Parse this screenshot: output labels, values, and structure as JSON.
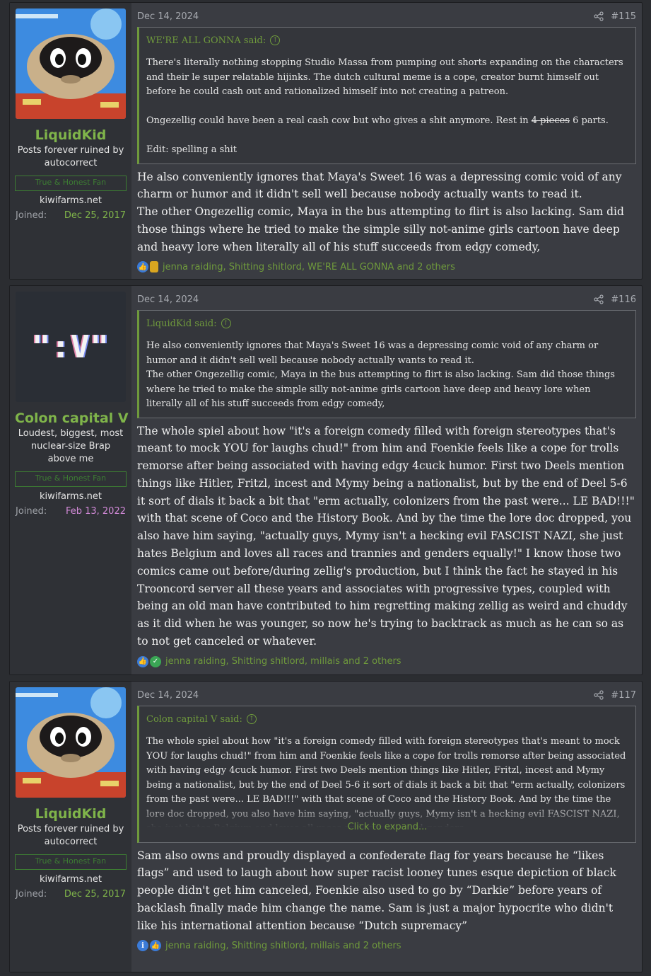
{
  "posts": [
    {
      "date": "Dec 14, 2024",
      "number": "#115",
      "user": {
        "name": "LiquidKid",
        "title": "Posts forever ruined by autocorrect",
        "banner": "True & Honest Fan",
        "site": "kiwifarms.net",
        "joined_label": "Joined:",
        "joined": "Dec 25, 2017"
      },
      "quote": {
        "author": "WE'RE ALL GONNA said:",
        "p1": "There's literally nothing stopping Studio Massa from pumping out shorts expanding on the characters and their le super relatable hijinks. The dutch cultural meme is a cope, creator burnt himself out before he could cash out and rationalized himself into not creating a patreon.",
        "p2_a": "Ongezellig could have been a real cash cow but who gives a shit anymore. Rest in",
        "p2_strike": "4 pieces",
        "p2_b": "6 parts.",
        "p3": "Edit: spelling a shit"
      },
      "message": [
        "He also conveniently ignores that Maya's Sweet 16 was a depressing comic void of any charm or humor and it didn't sell well because nobody actually wants to read it.",
        "The other Ongezellig comic, Maya in the bus attempting to flirt is also lacking. Sam did those things where he tried to make the simple silly not-anime girls cartoon have deep and heavy lore when literally all of his stuff succeeds from edgy comedy,"
      ],
      "reactions": "jenna raiding, Shitting shitlord, WE'RE ALL GONNA and 2 others"
    },
    {
      "date": "Dec 14, 2024",
      "number": "#116",
      "user": {
        "name": "Colon capital V",
        "avatar_text": "\":V\"",
        "title": "Loudest, biggest, most nuclear-size Brap above me",
        "banner": "True & Honest Fan",
        "site": "kiwifarms.net",
        "joined_label": "Joined:",
        "joined": "Feb 13, 2022"
      },
      "quote": {
        "author": "LiquidKid said:",
        "p1": "He also conveniently ignores that Maya's Sweet 16 was a depressing comic void of any charm or humor and it didn't sell well because nobody actually wants to read it.",
        "p2": "The other Ongezellig comic, Maya in the bus attempting to flirt is also lacking. Sam did those things where he tried to make the simple silly not-anime girls cartoon have deep and heavy lore when literally all of his stuff succeeds from edgy comedy,"
      },
      "message": [
        "The whole spiel about how \"it's a foreign comedy filled with foreign stereotypes that's meant to mock YOU for laughs chud!\" from him and Foenkie feels like a cope for trolls remorse after being associated with having edgy 4cuck humor. First two Deels mention things like Hitler, Fritzl, incest and Mymy being a nationalist, but by the end of Deel 5-6 it sort of dials it back a bit that \"erm actually, colonizers from the past were... LE BAD!!!\" with that scene of Coco and the History Book. And by the time the lore doc dropped, you also have him saying, \"actually guys, Mymy isn't a hecking evil FASCIST NAZI, she just hates Belgium and loves all races and trannies and genders equally!\" I know those two comics came out before/during zellig's production, but I think the fact he stayed in his Trooncord server all these years and associates with progressive types, coupled with being an old man have contributed to him regretting making zellig as weird and chuddy as it did when he was younger, so now he's trying to backtrack as much as he can so as to not get canceled or whatever."
      ],
      "reactions": "jenna raiding, Shitting shitlord, millais and 2 others"
    },
    {
      "date": "Dec 14, 2024",
      "number": "#117",
      "user": {
        "name": "LiquidKid",
        "title": "Posts forever ruined by autocorrect",
        "banner": "True & Honest Fan",
        "site": "kiwifarms.net",
        "joined_label": "Joined:",
        "joined": "Dec 25, 2017"
      },
      "quote": {
        "author": "Colon capital V said:",
        "p1": "The whole spiel about how \"it's a foreign comedy filled with foreign stereotypes that's meant to mock YOU for laughs chud!\" from him and Foenkie feels like a cope for trolls remorse after being associated with having edgy 4cuck humor. First two Deels mention things like Hitler, Fritzl, incest and Mymy being a nationalist, but by the end of Deel 5-6 it sort of dials it back a bit that \"erm actually, colonizers from the past were... LE BAD!!!\" with that scene of Coco and the History Book. And by the time the lore doc dropped, you also have him saying, \"actually guys, Mymy isn't a hecking evil FASCIST NAZI, she just hates Belgium and loves all races and trannies and genders",
        "expand": "Click to expand..."
      },
      "message": [
        "Sam also owns and proudly displayed a confederate flag for years because he “likes flags” and used to laugh about how super racist looney tunes esque depiction of black people didn't get him canceled, Foenkie also used to go by “Darkie” before years of backlash finally made him change the name. Sam is just a major hypocrite who didn't like his international attention because “Dutch supremacy”"
      ],
      "reactions": "jenna raiding, Shitting shitlord, millais and 2 others"
    }
  ],
  "colors": {
    "username": "#7fb44a",
    "joined_purple": "#d28ad8",
    "quote_accent": "#6f9a3c",
    "like_blue": "#3b7bd8"
  }
}
